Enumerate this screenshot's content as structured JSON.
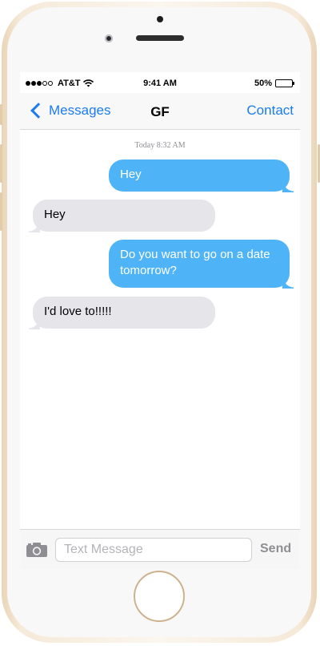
{
  "status_bar": {
    "carrier": "AT&T",
    "time": "9:41 AM",
    "battery_percent_label": "50%",
    "battery_level": 0.5,
    "signal_bars_filled": 3,
    "signal_bars_total": 5
  },
  "nav": {
    "back_label": "Messages",
    "title": "GF",
    "contact_label": "Contact"
  },
  "thread": {
    "timestamp": "Today 8:32 AM",
    "messages": [
      {
        "direction": "out",
        "text": "Hey"
      },
      {
        "direction": "in",
        "text": "Hey"
      },
      {
        "direction": "out",
        "text": "Do you want to go on a date tomorrow?"
      },
      {
        "direction": "in",
        "text": "I'd love to!!!!!"
      }
    ]
  },
  "composer": {
    "placeholder": "Text Message",
    "value": "",
    "send_label": "Send"
  },
  "colors": {
    "accent": "#1b7cf0",
    "outgoing_bubble": "#4fb4f7",
    "incoming_bubble": "#e5e5ea",
    "phone_frame": "#f6ead9"
  },
  "icons": {
    "back": "chevron-left-icon",
    "camera": "camera-icon",
    "wifi": "wifi-icon",
    "battery": "battery-icon"
  }
}
